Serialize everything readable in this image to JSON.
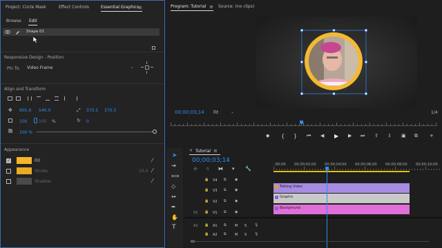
{
  "left_panel": {
    "tabs": {
      "project": "Project: Circle Mask",
      "effect_controls": "Effect Controls",
      "essential_graphics": "Essential Graphics"
    },
    "subtabs": {
      "browse": "Browse",
      "edit": "Edit"
    },
    "layer_name": "Shape 01",
    "responsive": {
      "title": "Responsive Design - Position",
      "pin_to_label": "Pin To:",
      "pin_to_value": "Video Frame"
    },
    "align": {
      "title": "Align and Transform",
      "pos_x": "905.9",
      "pos_y": "540.0",
      "anchor_x": "370.5",
      "anchor_y": "370.5",
      "scale": "100",
      "scale_h": "100",
      "scale_unit": "%",
      "rotation": "0",
      "opacity": "100 %"
    },
    "appearance": {
      "title": "Appearance",
      "fill_label": "Fill",
      "fill_color": "#f4b72c",
      "stroke_label": "Stroke",
      "stroke_color": "#e9ac24",
      "stroke_value": "10.0",
      "shadow_label": "Shadow",
      "shadow_color": "#4a4a4a"
    }
  },
  "program": {
    "tabs": {
      "program": "Program: Tutorial",
      "source": "Source: (no clips)"
    },
    "timecode": "00;00;03;14",
    "fit": "Fit",
    "ratio": "1/4",
    "ring_color": "#f3b933",
    "selection_color": "#2f82e8"
  },
  "timeline": {
    "tab": "Tutorial",
    "timecode": "00;00;03;14",
    "ruler": [
      ":00;00",
      "00;00;02;00",
      "00;00;04;00",
      "00;00;06;00",
      "00;00;08;00",
      "00;00;10;00"
    ],
    "tracks": [
      {
        "name": "V4"
      },
      {
        "name": "V3"
      },
      {
        "name": "V2"
      },
      {
        "name": "V1",
        "src": "V1"
      },
      {
        "name": "A1",
        "src": "A1"
      },
      {
        "name": "A2"
      }
    ],
    "clips": {
      "talking": {
        "label": "Talking Video",
        "color": "#a88be3"
      },
      "graphic": {
        "label": "Graphic",
        "color": "#c9c9c9"
      },
      "background": {
        "label": "Background",
        "color": "#df6fd9"
      }
    },
    "mute": "M",
    "solo": "S"
  }
}
